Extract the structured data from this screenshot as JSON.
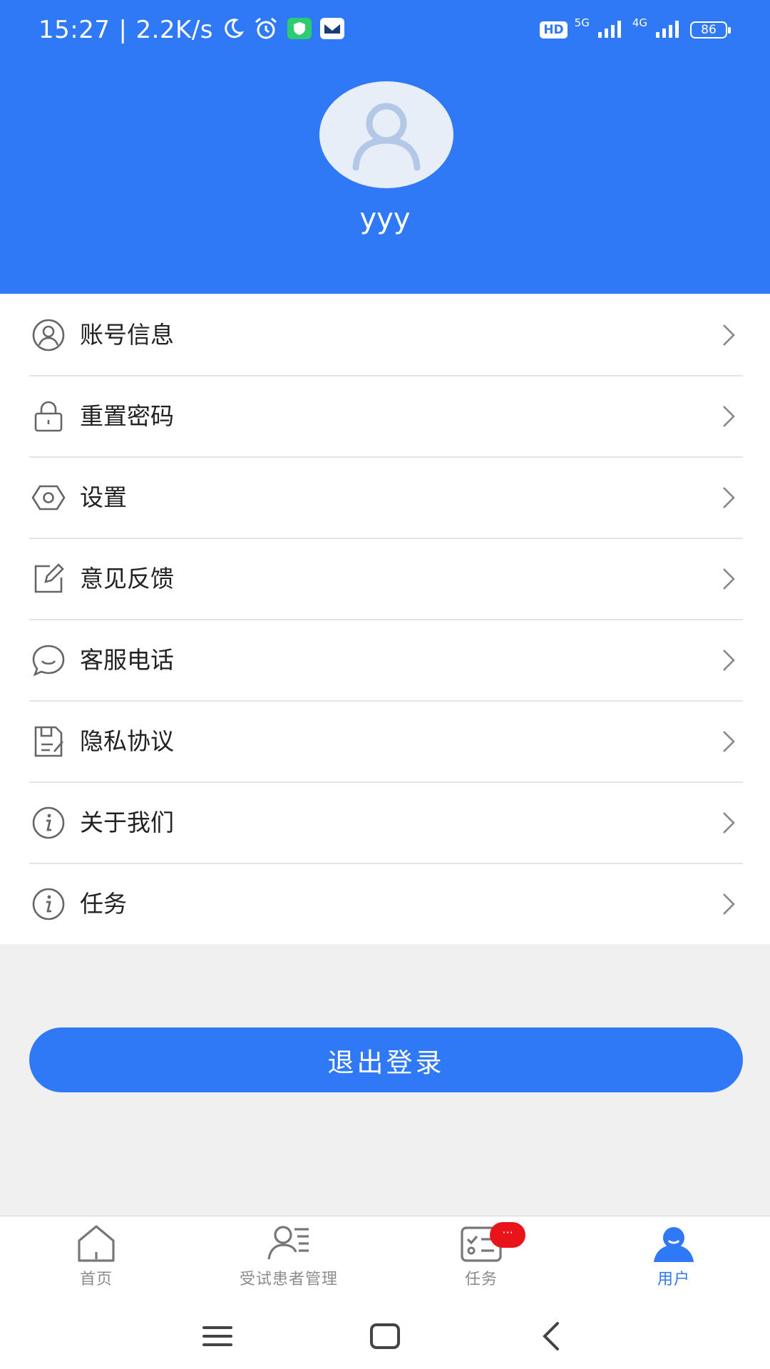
{
  "status_bar": {
    "time": "15:27",
    "speed": "2.2K/s",
    "hd": "HD",
    "net_5g": "5G",
    "net_4g": "4G",
    "battery": "86",
    "icons": [
      "moon-icon",
      "alarm-icon",
      "shield-app-icon",
      "mail-app-icon",
      "signal-icon"
    ]
  },
  "profile": {
    "username": "yyy",
    "avatar_icon": "user-avatar-icon"
  },
  "menu": [
    {
      "label": "账号信息",
      "icon": "user-circle-icon"
    },
    {
      "label": "重置密码",
      "icon": "lock-icon"
    },
    {
      "label": "设置",
      "icon": "settings-hexagon-icon"
    },
    {
      "label": "意见反馈",
      "icon": "edit-icon"
    },
    {
      "label": "客服电话",
      "icon": "chat-bubble-icon"
    },
    {
      "label": "隐私协议",
      "icon": "document-icon"
    },
    {
      "label": "关于我们",
      "icon": "info-icon"
    },
    {
      "label": "任务",
      "icon": "info-icon"
    }
  ],
  "logout": {
    "label": "退出登录"
  },
  "tabs": [
    {
      "label": "首页",
      "icon": "home-icon",
      "active": false
    },
    {
      "label": "受试患者管理",
      "icon": "patient-list-icon",
      "active": false
    },
    {
      "label": "任务",
      "icon": "task-icon",
      "active": false,
      "badge": "···"
    },
    {
      "label": "用户",
      "icon": "user-icon",
      "active": true
    }
  ],
  "colors": {
    "primary": "#2f78f6",
    "badge": "#e8141a",
    "inactive": "#8c8c8c",
    "background": "#f0f0f0"
  }
}
